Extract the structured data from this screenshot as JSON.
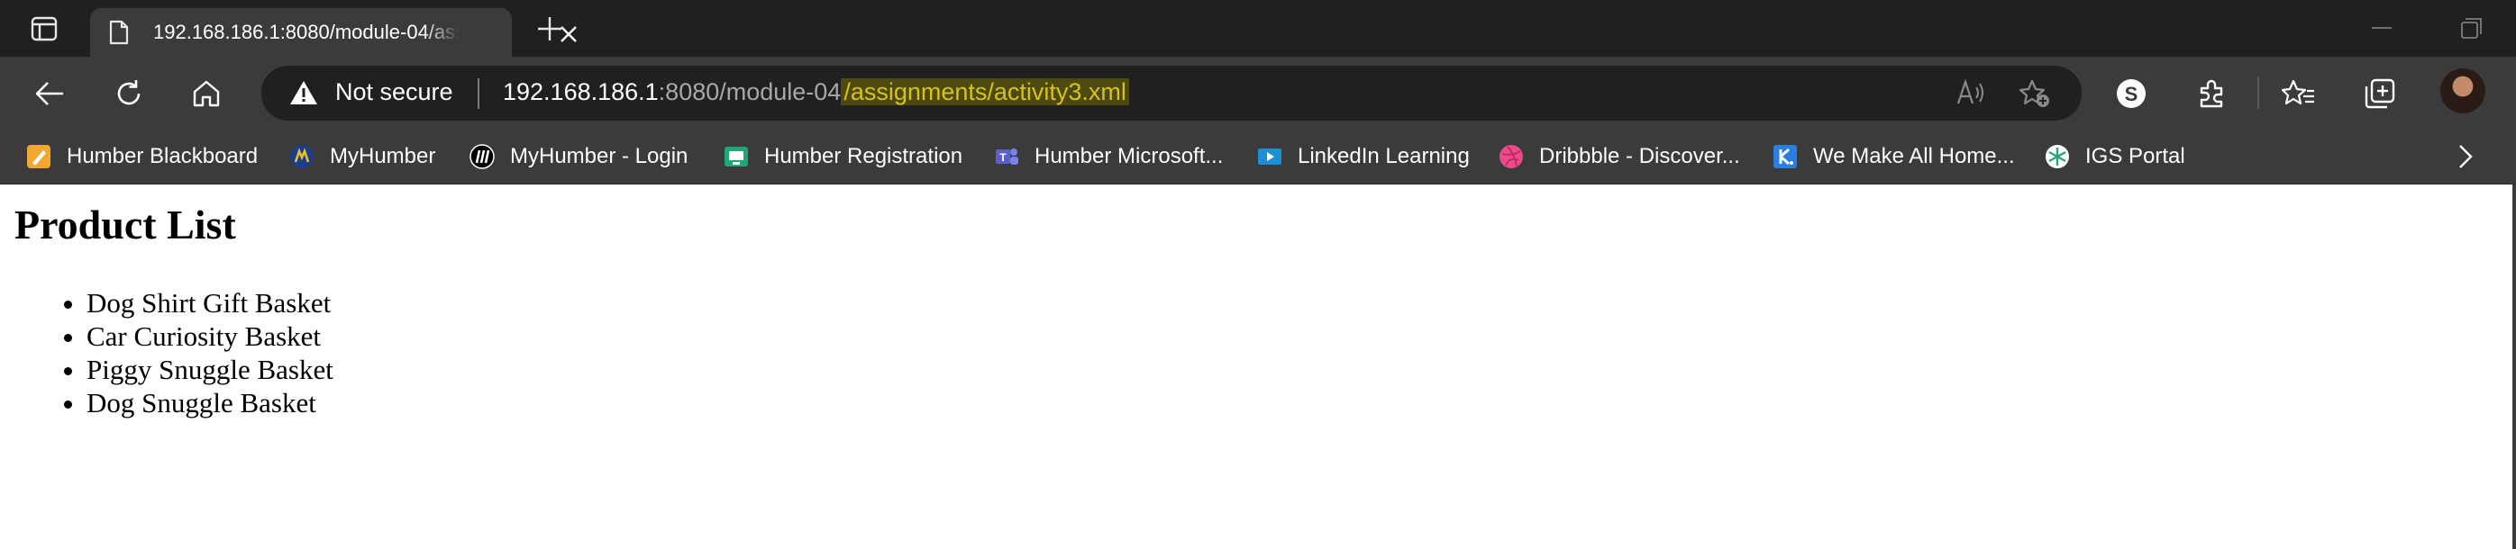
{
  "tab": {
    "title": "192.168.186.1:8080/module-04/assignments/activity3.xml"
  },
  "toolbar": {
    "security_label": "Not secure",
    "url": {
      "host": "192.168.186.1",
      "port_path": ":8080/module-04",
      "highlight": "/assignments/activity3.xml"
    }
  },
  "bookmarks": [
    {
      "label": "Humber Blackboard",
      "icon": "blackboard-icon",
      "color": "#f0a830"
    },
    {
      "label": "MyHumber",
      "icon": "myhumber-icon",
      "color": "#1c3d8c"
    },
    {
      "label": "MyHumber - Login",
      "icon": "myhumber-login-icon",
      "color": "#000000"
    },
    {
      "label": "Humber Registration",
      "icon": "registration-icon",
      "color": "#1fa67a"
    },
    {
      "label": "Humber Microsoft...",
      "icon": "teams-icon",
      "color": "#5b5fc7"
    },
    {
      "label": "LinkedIn Learning",
      "icon": "linkedin-learning-icon",
      "color": "#1d8fd6"
    },
    {
      "label": "Dribbble - Discover...",
      "icon": "dribbble-icon",
      "color": "#ea4c89"
    },
    {
      "label": "We Make All Home...",
      "icon": "kajabi-icon",
      "color": "#2a7de1"
    },
    {
      "label": "IGS Portal",
      "icon": "igs-icon",
      "color": "#ffffff"
    }
  ],
  "page": {
    "title": "Product List",
    "products": [
      "Dog Shirt Gift Basket",
      "Car Curiosity Basket",
      "Piggy Snuggle Basket",
      "Dog Snuggle Basket"
    ]
  }
}
